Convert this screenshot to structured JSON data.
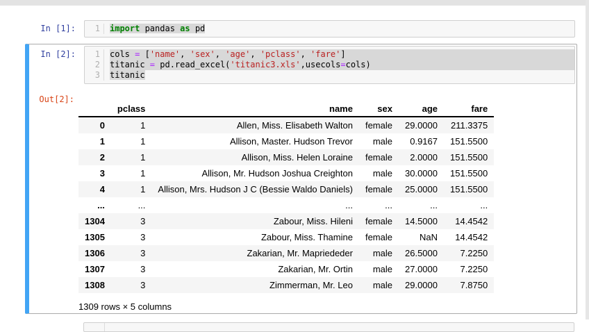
{
  "colors": {
    "prompt_in": "#303F9F",
    "prompt_out": "#D84315",
    "selected_cell_bar": "#42A5F5",
    "cell_border": "#ababab",
    "input_bg": "#f7f7f7",
    "input_border": "#cfcfcf",
    "selection_bg": "#d8d8d8",
    "row_stripe": "#f5f5f5",
    "keyword": "#008000",
    "operator": "#AA22FF",
    "string": "#BA2121"
  },
  "cells": [
    {
      "prompt": "In [1]:",
      "gutter": [
        "1"
      ],
      "lines": [
        {
          "sel": "text",
          "tokens": [
            {
              "c": "kw",
              "t": "import"
            },
            {
              "c": "",
              "t": " pandas "
            },
            {
              "c": "kw",
              "t": "as"
            },
            {
              "c": "",
              "t": " pd"
            }
          ]
        }
      ]
    },
    {
      "prompt": "In [2]:",
      "prompt_out": "Out[2]:",
      "gutter": [
        "1",
        "2",
        "3"
      ],
      "lines": [
        {
          "sel": "full",
          "tokens": [
            {
              "c": "",
              "t": "cols "
            },
            {
              "c": "op",
              "t": "="
            },
            {
              "c": "",
              "t": " ["
            },
            {
              "c": "str",
              "t": "'name'"
            },
            {
              "c": "",
              "t": ", "
            },
            {
              "c": "str",
              "t": "'sex'"
            },
            {
              "c": "",
              "t": ", "
            },
            {
              "c": "str",
              "t": "'age'"
            },
            {
              "c": "",
              "t": ", "
            },
            {
              "c": "str",
              "t": "'pclass'"
            },
            {
              "c": "",
              "t": ", "
            },
            {
              "c": "str",
              "t": "'fare'"
            },
            {
              "c": "",
              "t": "]"
            }
          ]
        },
        {
          "sel": "full",
          "tokens": [
            {
              "c": "",
              "t": "titanic "
            },
            {
              "c": "op",
              "t": "="
            },
            {
              "c": "",
              "t": " pd.read_excel("
            },
            {
              "c": "str",
              "t": "'titanic3.xls'"
            },
            {
              "c": "",
              "t": ",usecols"
            },
            {
              "c": "op",
              "t": "="
            },
            {
              "c": "",
              "t": "cols)"
            }
          ]
        },
        {
          "sel": "text",
          "tokens": [
            {
              "c": "",
              "t": "titanic"
            }
          ]
        }
      ],
      "table": {
        "index_header": "",
        "columns": [
          "pclass",
          "name",
          "sex",
          "age",
          "fare"
        ],
        "rows": [
          [
            "0",
            "1",
            "Allen, Miss. Elisabeth Walton",
            "female",
            "29.0000",
            "211.3375"
          ],
          [
            "1",
            "1",
            "Allison, Master. Hudson Trevor",
            "male",
            "0.9167",
            "151.5500"
          ],
          [
            "2",
            "1",
            "Allison, Miss. Helen Loraine",
            "female",
            "2.0000",
            "151.5500"
          ],
          [
            "3",
            "1",
            "Allison, Mr. Hudson Joshua Creighton",
            "male",
            "30.0000",
            "151.5500"
          ],
          [
            "4",
            "1",
            "Allison, Mrs. Hudson J C (Bessie Waldo Daniels)",
            "female",
            "25.0000",
            "151.5500"
          ],
          [
            "...",
            "...",
            "...",
            "...",
            "...",
            "..."
          ],
          [
            "1304",
            "3",
            "Zabour, Miss. Hileni",
            "female",
            "14.5000",
            "14.4542"
          ],
          [
            "1305",
            "3",
            "Zabour, Miss. Thamine",
            "female",
            "NaN",
            "14.4542"
          ],
          [
            "1306",
            "3",
            "Zakarian, Mr. Mapriededer",
            "male",
            "26.5000",
            "7.2250"
          ],
          [
            "1307",
            "3",
            "Zakarian, Mr. Ortin",
            "male",
            "27.0000",
            "7.2250"
          ],
          [
            "1308",
            "3",
            "Zimmerman, Mr. Leo",
            "male",
            "29.0000",
            "7.8750"
          ]
        ],
        "summary": "1309 rows × 5 columns"
      }
    }
  ]
}
